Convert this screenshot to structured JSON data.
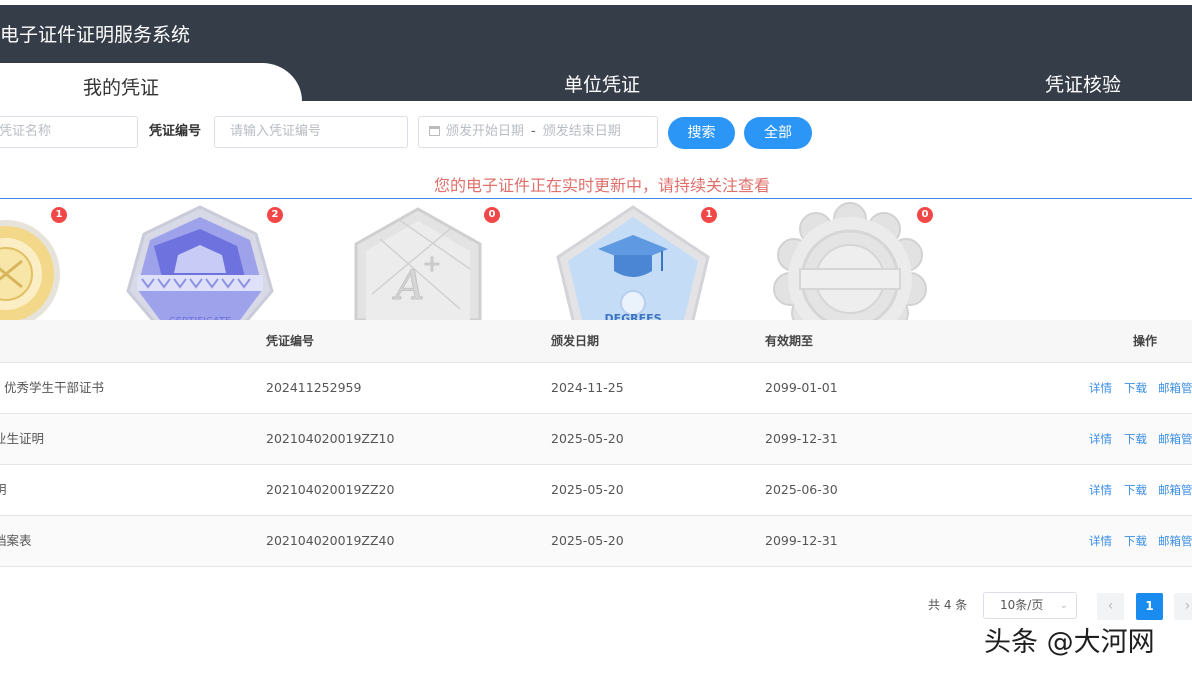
{
  "app": {
    "title": "电子证件证明服务系统",
    "tabs": [
      {
        "label": "我的凭证",
        "active": true
      },
      {
        "label": "单位凭证",
        "active": false
      },
      {
        "label": "凭证核验",
        "active": false
      }
    ]
  },
  "search": {
    "name_placeholder": "凭证名称",
    "number_label": "凭证编号",
    "number_placeholder": "请输入凭证编号",
    "date_start_placeholder": "颁发开始日期",
    "date_separator": "-",
    "date_end_placeholder": "颁发结束日期",
    "search_button": "搜索",
    "all_button": "全部"
  },
  "notice": "您的电子证件正在实时更新中，请持续关注查看",
  "badges": [
    {
      "icon": "gold-medal-icon",
      "count": "1"
    },
    {
      "icon": "certificate-badge-icon",
      "count": "2",
      "text": "CERTIFICATE"
    },
    {
      "icon": "grade-a-badge-icon",
      "count": "0"
    },
    {
      "icon": "degree-badge-icon",
      "count": "1",
      "text": "DEGREES"
    },
    {
      "icon": "flower-seal-badge-icon",
      "count": "0"
    }
  ],
  "table": {
    "headers": {
      "number": "凭证编号",
      "issue_date": "颁发日期",
      "valid_until": "有效期至",
      "actions": "操作"
    },
    "rows": [
      {
        "name": "优秀学生干部证书",
        "number": "202411252959",
        "issue_date": "2024-11-25",
        "valid_until": "2099-01-01"
      },
      {
        "name": "业生证明",
        "number": "202104020019ZZ10",
        "issue_date": "2025-05-20",
        "valid_until": "2099-12-31"
      },
      {
        "name": "明",
        "number": "202104020019ZZ20",
        "issue_date": "2025-05-20",
        "valid_until": "2025-06-30"
      },
      {
        "name": "档案表",
        "number": "202104020019ZZ40",
        "issue_date": "2025-05-20",
        "valid_until": "2099-12-31"
      }
    ],
    "actions": {
      "detail": "详情",
      "download": "下载",
      "mailbox": "邮箱管"
    }
  },
  "pagination": {
    "total": "共 4 条",
    "page_size": "10条/页",
    "current_page": "1"
  },
  "watermark": "头条 @大河网",
  "colors": {
    "header_bg": "#353d48",
    "primary": "#2b96f6",
    "notice": "#e0706b",
    "badge_count": "#f04848"
  }
}
